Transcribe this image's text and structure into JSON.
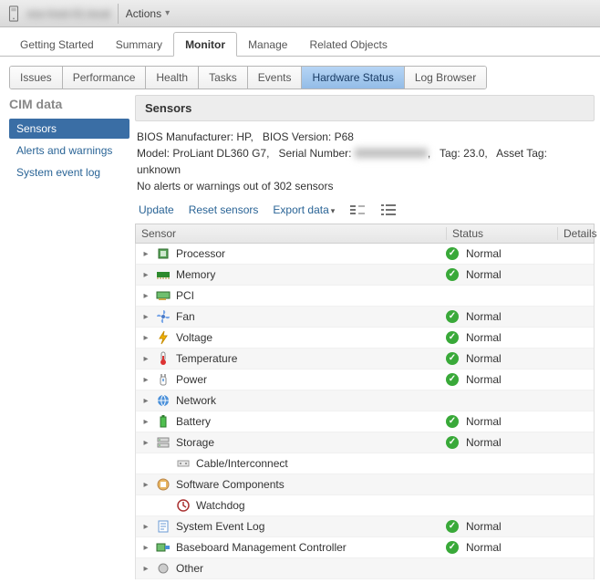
{
  "toolbar": {
    "host_name": "esx-host-01.local",
    "actions_label": "Actions"
  },
  "main_tabs": [
    {
      "label": "Getting Started",
      "active": false
    },
    {
      "label": "Summary",
      "active": false
    },
    {
      "label": "Monitor",
      "active": true
    },
    {
      "label": "Manage",
      "active": false
    },
    {
      "label": "Related Objects",
      "active": false
    }
  ],
  "sub_tabs": [
    {
      "label": "Issues",
      "active": false
    },
    {
      "label": "Performance",
      "active": false
    },
    {
      "label": "Health",
      "active": false
    },
    {
      "label": "Tasks",
      "active": false
    },
    {
      "label": "Events",
      "active": false
    },
    {
      "label": "Hardware Status",
      "active": true
    },
    {
      "label": "Log Browser",
      "active": false
    }
  ],
  "left_nav": {
    "title": "CIM data",
    "items": [
      {
        "label": "Sensors",
        "selected": true
      },
      {
        "label": "Alerts and warnings",
        "selected": false
      },
      {
        "label": "System event log",
        "selected": false
      }
    ]
  },
  "panel": {
    "title": "Sensors",
    "meta": {
      "bios_manufacturer_label": "BIOS Manufacturer:",
      "bios_manufacturer": "HP",
      "bios_version_label": "BIOS Version:",
      "bios_version": "P68",
      "model_label": "Model:",
      "model": "ProLiant DL360 G7",
      "serial_label": "Serial Number:",
      "serial": "XXXXXXXXXX",
      "tag_label": "Tag:",
      "tag": "23.0",
      "asset_tag_label": "Asset Tag:",
      "asset_tag": "unknown",
      "summary": "No alerts or warnings out of 302 sensors"
    },
    "tools": {
      "update": "Update",
      "reset": "Reset sensors",
      "export": "Export data"
    },
    "columns": {
      "sensor": "Sensor",
      "status": "Status",
      "details": "Details"
    },
    "status_normal": "Normal",
    "rows": [
      {
        "name": "Processor",
        "icon": "cpu",
        "expandable": true,
        "status": "Normal"
      },
      {
        "name": "Memory",
        "icon": "memory",
        "expandable": true,
        "status": "Normal"
      },
      {
        "name": "PCI",
        "icon": "pci",
        "expandable": true,
        "status": ""
      },
      {
        "name": "Fan",
        "icon": "fan",
        "expandable": true,
        "status": "Normal"
      },
      {
        "name": "Voltage",
        "icon": "voltage",
        "expandable": true,
        "status": "Normal"
      },
      {
        "name": "Temperature",
        "icon": "temperature",
        "expandable": true,
        "status": "Normal"
      },
      {
        "name": "Power",
        "icon": "power",
        "expandable": true,
        "status": "Normal"
      },
      {
        "name": "Network",
        "icon": "network",
        "expandable": true,
        "status": ""
      },
      {
        "name": "Battery",
        "icon": "battery",
        "expandable": true,
        "status": "Normal"
      },
      {
        "name": "Storage",
        "icon": "storage",
        "expandable": true,
        "status": "Normal"
      },
      {
        "name": "Cable/Interconnect",
        "icon": "cable",
        "expandable": false,
        "status": ""
      },
      {
        "name": "Software Components",
        "icon": "software",
        "expandable": true,
        "status": ""
      },
      {
        "name": "Watchdog",
        "icon": "watchdog",
        "expandable": false,
        "status": ""
      },
      {
        "name": "System Event Log",
        "icon": "log",
        "expandable": true,
        "status": "Normal"
      },
      {
        "name": "Baseboard Management Controller",
        "icon": "bmc",
        "expandable": true,
        "status": "Normal"
      },
      {
        "name": "Other",
        "icon": "other",
        "expandable": true,
        "status": ""
      }
    ]
  }
}
